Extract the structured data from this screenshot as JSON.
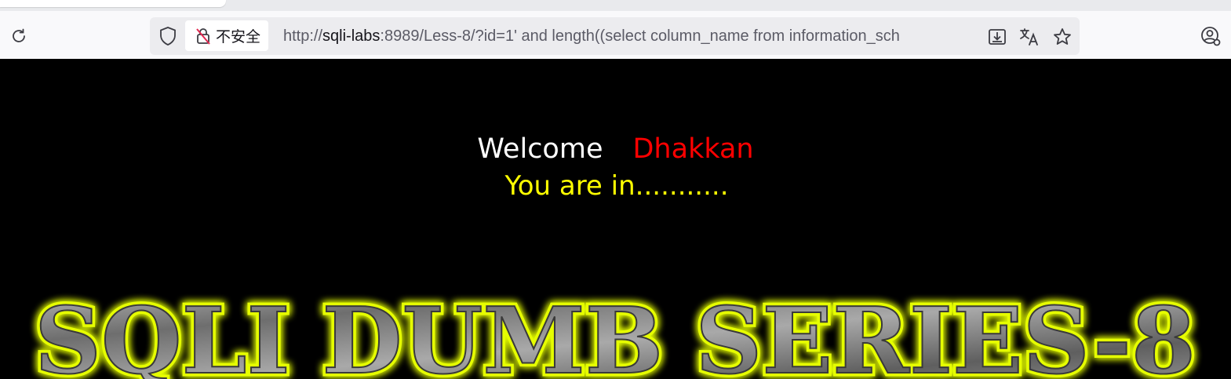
{
  "browser": {
    "security_label": "不安全",
    "url_prefix": "http://",
    "url_host": "sqli-labs",
    "url_rest": ":8989/Less-8/?id=1' and length((select column_name from information_sch"
  },
  "page": {
    "welcome": "Welcome",
    "name": "Dhakkan",
    "status": "You are in...........",
    "banner": "SQLI DUMB SERIES-8"
  },
  "colors": {
    "background": "#000000",
    "welcome": "#ffffff",
    "name": "#ff0000",
    "status": "#ffff00",
    "banner_glow": "#e6ff00",
    "banner_metal": "#8a8a8a"
  },
  "icons": [
    "reload-icon",
    "shield-icon",
    "insecure-lock-icon",
    "reader-view-icon",
    "translate-icon",
    "bookmark-star-icon",
    "account-icon"
  ]
}
